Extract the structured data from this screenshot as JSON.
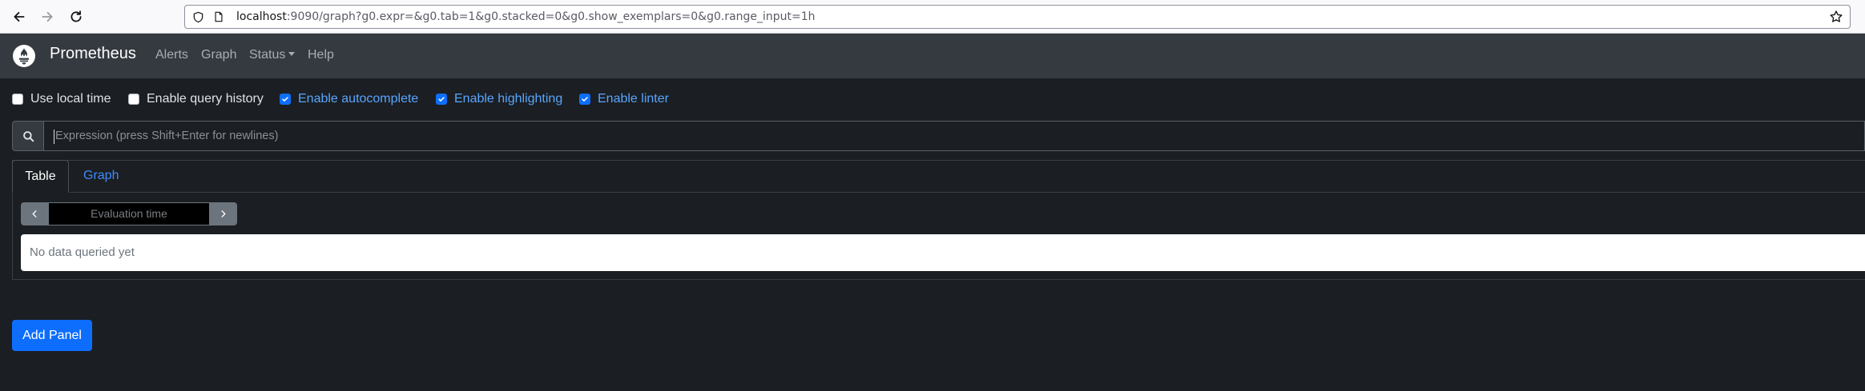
{
  "browser": {
    "url_host": "localhost",
    "url_rest": ":9090/graph?g0.expr=&g0.tab=1&g0.stacked=0&g0.show_exemplars=0&g0.range_input=1h",
    "icons": [
      "back-icon",
      "forward-icon",
      "reload-icon",
      "shield-icon",
      "page-icon",
      "star-icon"
    ]
  },
  "navbar": {
    "brand": "Prometheus",
    "links": {
      "alerts": "Alerts",
      "graph": "Graph",
      "status": "Status",
      "help": "Help"
    }
  },
  "options": [
    {
      "label": "Use local time",
      "checked": false
    },
    {
      "label": "Enable query history",
      "checked": false
    },
    {
      "label": "Enable autocomplete",
      "checked": true
    },
    {
      "label": "Enable highlighting",
      "checked": true
    },
    {
      "label": "Enable linter",
      "checked": true
    }
  ],
  "expression": {
    "placeholder": "Expression (press Shift+Enter for newlines)",
    "value": ""
  },
  "panel": {
    "tabs": {
      "table": "Table",
      "graph": "Graph"
    },
    "active_tab": "Table",
    "eval_placeholder": "Evaluation time",
    "result_text": "No data queried yet"
  },
  "add_panel_label": "Add Panel",
  "colors": {
    "background": "#1b1e22",
    "navbar": "#343a40",
    "accent": "#0d6efd",
    "link": "#3d8bfd"
  }
}
